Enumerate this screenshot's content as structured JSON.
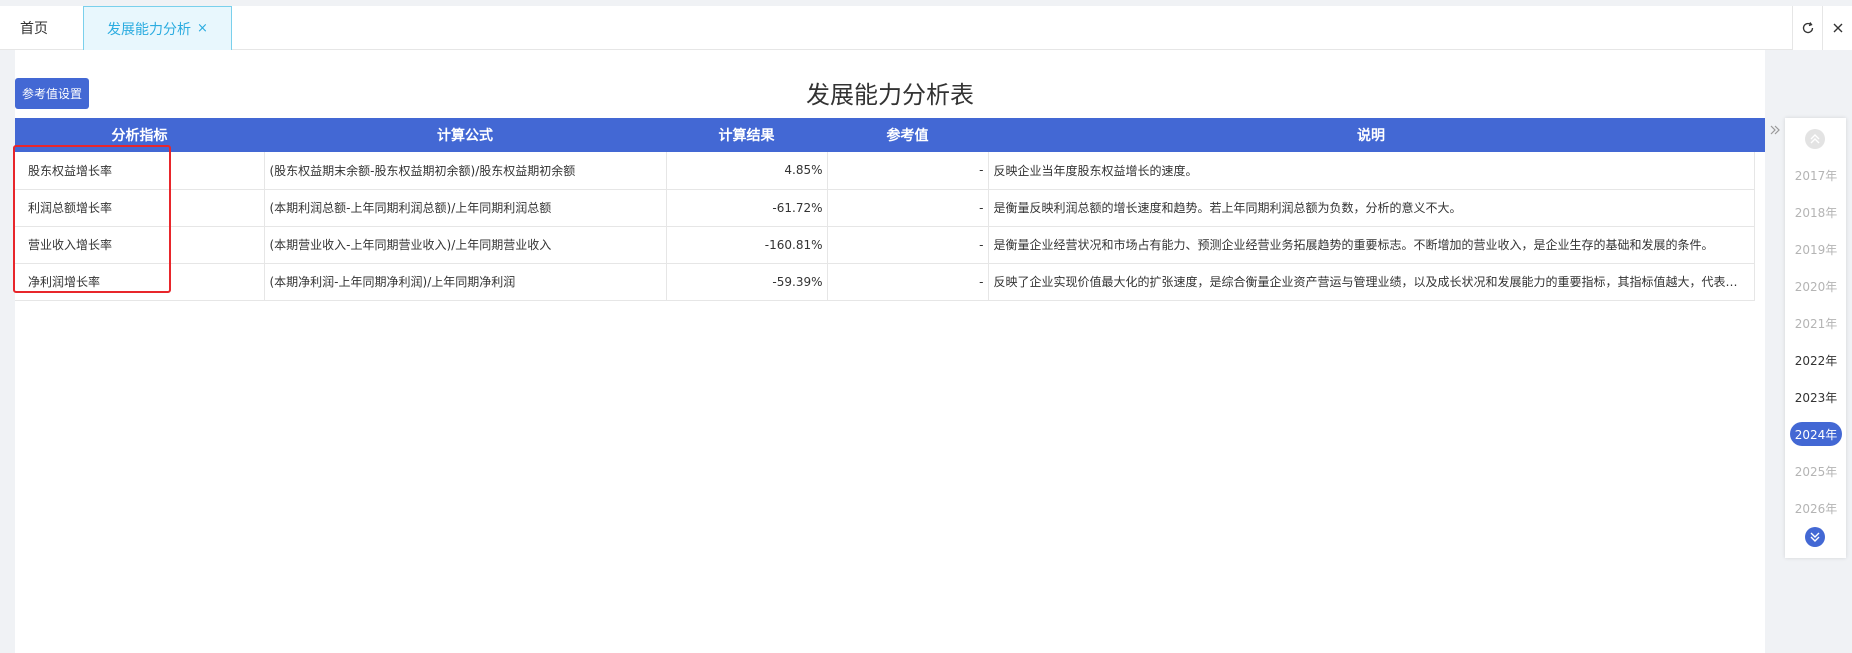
{
  "tabs": {
    "home": "首页",
    "active": "发展能力分析",
    "close_glyph": "×"
  },
  "toolbar": {
    "ref_button": "参考值设置"
  },
  "page": {
    "title": "发展能力分析表"
  },
  "table": {
    "headers": [
      "分析指标",
      "计算公式",
      "计算结果",
      "参考值",
      "说明"
    ],
    "rows": [
      {
        "indicator": "股东权益增长率",
        "formula": "(股东权益期末余额-股东权益期初余额)/股东权益期初余额",
        "result": "4.85%",
        "reference": "-",
        "description": "反映企业当年度股东权益增长的速度。"
      },
      {
        "indicator": "利润总额增长率",
        "formula": "(本期利润总额-上年同期利润总额)/上年同期利润总额",
        "result": "-61.72%",
        "reference": "-",
        "description": "是衡量反映利润总额的增长速度和趋势。若上年同期利润总额为负数，分析的意义不大。"
      },
      {
        "indicator": "营业收入增长率",
        "formula": "(本期营业收入-上年同期营业收入)/上年同期营业收入",
        "result": "-160.81%",
        "reference": "-",
        "description": "是衡量企业经营状况和市场占有能力、预测企业经营业务拓展趋势的重要标志。不断增加的营业收入，是企业生存的基础和发展的条件。"
      },
      {
        "indicator": "净利润增长率",
        "formula": "(本期净利润-上年同期净利润)/上年同期净利润",
        "result": "-59.39%",
        "reference": "-",
        "description": "反映了企业实现价值最大化的扩张速度，是综合衡量企业资产营运与管理业绩，以及成长状况和发展能力的重要指标，其指标值越大，代表企..."
      }
    ]
  },
  "years": {
    "items": [
      {
        "label": "2017年",
        "state": "disabled"
      },
      {
        "label": "2018年",
        "state": "disabled"
      },
      {
        "label": "2019年",
        "state": "disabled"
      },
      {
        "label": "2020年",
        "state": "disabled"
      },
      {
        "label": "2021年",
        "state": "disabled"
      },
      {
        "label": "2022年",
        "state": "normal"
      },
      {
        "label": "2023年",
        "state": "normal"
      },
      {
        "label": "2024年",
        "state": "selected"
      },
      {
        "label": "2025年",
        "state": "disabled"
      },
      {
        "label": "2026年",
        "state": "disabled"
      }
    ]
  },
  "colors": {
    "accent": "#4368d4",
    "tab_active_text": "#2bace0",
    "highlight_border": "#e8262b"
  },
  "icons": {
    "refresh": "refresh-icon",
    "close": "close-icon",
    "expand": "double-chevron-right-icon",
    "up": "double-chevron-up-icon",
    "down": "double-chevron-down-icon"
  }
}
